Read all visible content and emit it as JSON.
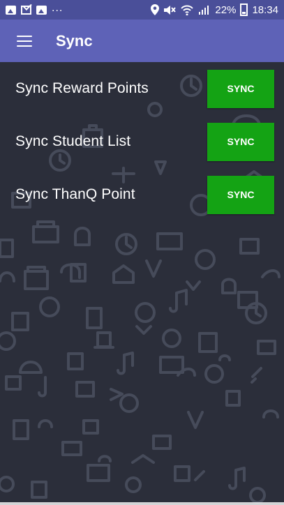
{
  "status_bar": {
    "more": "...",
    "battery": "22%",
    "time": "18:34",
    "icons": [
      "photo-icon",
      "mail-icon",
      "photo-icon",
      "location-icon",
      "mute-icon",
      "wifi-icon",
      "signal-icon",
      "battery-icon"
    ]
  },
  "app_bar": {
    "title": "Sync",
    "menu_icon": "hamburger-icon"
  },
  "sync_items": [
    {
      "label": "Sync Reward Points",
      "button": "SYNC"
    },
    {
      "label": "Sync Student List",
      "button": "SYNC"
    },
    {
      "label": "Sync ThanQ Point",
      "button": "SYNC"
    }
  ],
  "colors": {
    "status_bar": "#4a4f99",
    "app_bar": "#5e62b7",
    "background": "#2b2e3a",
    "sync_button": "#14a314",
    "text": "#ffffff"
  }
}
